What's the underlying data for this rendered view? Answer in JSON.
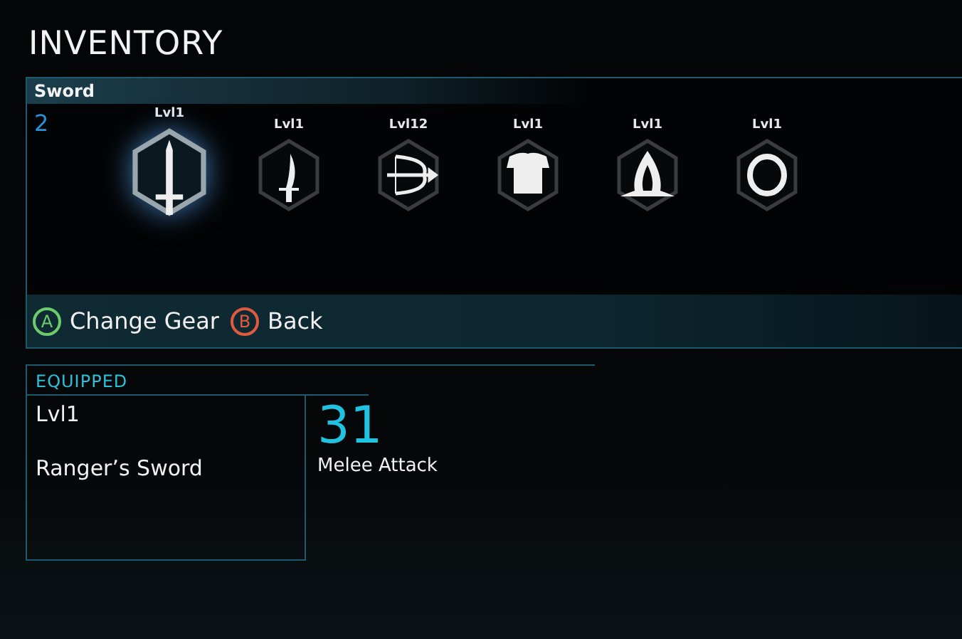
{
  "title": "INVENTORY",
  "gear_panel": {
    "category": "Sword",
    "count": "2",
    "items": [
      {
        "kind": "sword",
        "level": "Lvl1",
        "selected": true
      },
      {
        "kind": "dagger",
        "level": "Lvl1",
        "selected": false
      },
      {
        "kind": "bow",
        "level": "Lvl12",
        "selected": false
      },
      {
        "kind": "armor",
        "level": "Lvl1",
        "selected": false
      },
      {
        "kind": "hood",
        "level": "Lvl1",
        "selected": false
      },
      {
        "kind": "ring",
        "level": "Lvl1",
        "selected": false
      }
    ],
    "actions": [
      {
        "key": "A",
        "kind": "confirm",
        "label": "Change Gear"
      },
      {
        "key": "B",
        "kind": "cancel",
        "label": "Back"
      }
    ]
  },
  "equipped": {
    "heading": "EQUIPPED",
    "level": "Lvl1",
    "name": "Ranger’s Sword",
    "stat_value": "31",
    "stat_label": "Melee Attack"
  }
}
